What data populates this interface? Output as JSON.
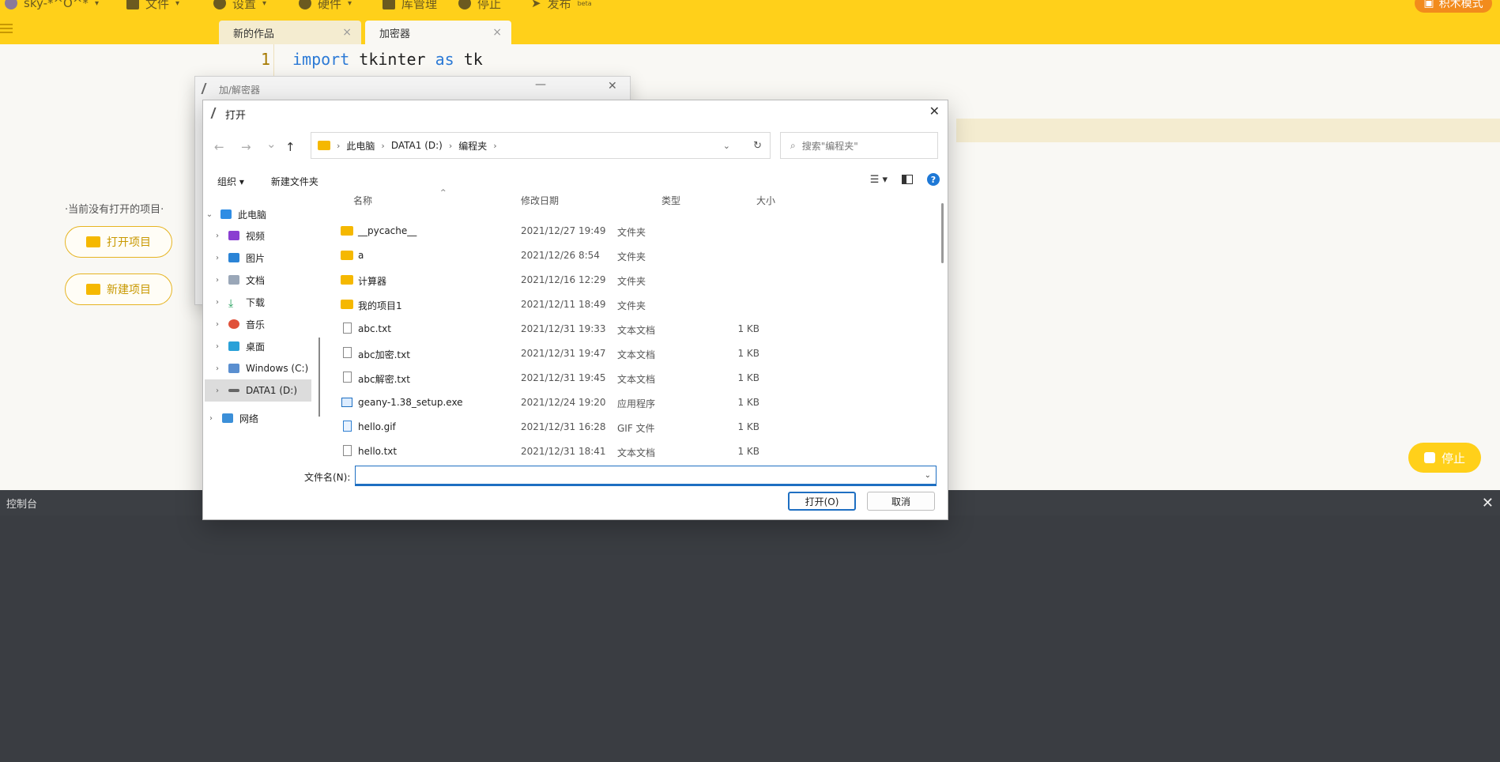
{
  "toolbar": {
    "user": "sky-*^O^*",
    "file": "文件",
    "settings": "设置",
    "hardware": "硬件",
    "library": "库管理",
    "stop": "停止",
    "publish": "发布",
    "publish_badge": "beta",
    "block_mode": "积木模式"
  },
  "tabs": [
    {
      "label": "新的作品",
      "close": "×"
    },
    {
      "label": "加密器",
      "close": "×"
    }
  ],
  "editor": {
    "line_number": "1",
    "code_kw1": "import",
    "code_mod": " tkinter ",
    "code_kw2": "as",
    "code_alias": " tk"
  },
  "project_pane": {
    "no_project": "·当前没有打开的项目·",
    "open_project": "打开项目",
    "new_project": "新建项目"
  },
  "stop_button": "停止",
  "console": {
    "title": "控制台",
    "close": "✕"
  },
  "bg_window": {
    "title": "加/解密器",
    "minimize": "—",
    "close": "✕"
  },
  "dialog": {
    "title": "打开",
    "close": "✕",
    "nav_back": "←",
    "nav_forward": "→",
    "nav_recent": "⌄",
    "nav_up": "↑",
    "breadcrumb": [
      "此电脑",
      "DATA1 (D:)",
      "编程夹"
    ],
    "search_placeholder": "搜索\"编程夹\"",
    "organize": "组织 ▾",
    "new_folder": "新建文件夹",
    "help": "?",
    "view_menu": "☰ ▾",
    "tree": [
      {
        "label": "此电脑",
        "expanded": true
      },
      {
        "label": "视频"
      },
      {
        "label": "图片"
      },
      {
        "label": "文档"
      },
      {
        "label": "下载"
      },
      {
        "label": "音乐"
      },
      {
        "label": "桌面"
      },
      {
        "label": "Windows (C:)"
      },
      {
        "label": "DATA1 (D:)",
        "selected": true
      },
      {
        "label": "网络"
      }
    ],
    "columns": {
      "name": "名称",
      "date": "修改日期",
      "type": "类型",
      "size": "大小"
    },
    "files": [
      {
        "name": "__pycache__",
        "date": "2021/12/27 19:49",
        "type": "文件夹",
        "size": "",
        "kind": "folder"
      },
      {
        "name": "a",
        "date": "2021/12/26 8:54",
        "type": "文件夹",
        "size": "",
        "kind": "folder"
      },
      {
        "name": "计算器",
        "date": "2021/12/16 12:29",
        "type": "文件夹",
        "size": "",
        "kind": "folder"
      },
      {
        "name": "我的项目1",
        "date": "2021/12/11 18:49",
        "type": "文件夹",
        "size": "",
        "kind": "folder"
      },
      {
        "name": "abc.txt",
        "date": "2021/12/31 19:33",
        "type": "文本文档",
        "size": "1 KB",
        "kind": "txt"
      },
      {
        "name": "abc加密.txt",
        "date": "2021/12/31 19:47",
        "type": "文本文档",
        "size": "1 KB",
        "kind": "txt"
      },
      {
        "name": "abc解密.txt",
        "date": "2021/12/31 19:45",
        "type": "文本文档",
        "size": "1 KB",
        "kind": "txt"
      },
      {
        "name": "geany-1.38_setup.exe",
        "date": "2021/12/24 19:20",
        "type": "应用程序",
        "size": "1 KB",
        "kind": "exe"
      },
      {
        "name": "hello.gif",
        "date": "2021/12/31 16:28",
        "type": "GIF 文件",
        "size": "1 KB",
        "kind": "gif"
      },
      {
        "name": "hello.txt",
        "date": "2021/12/31 18:41",
        "type": "文本文档",
        "size": "1 KB",
        "kind": "txt"
      }
    ],
    "filename_label": "文件名(N):",
    "filename_value": "",
    "open_button": "打开(O)",
    "cancel_button": "取消"
  },
  "colors": {
    "accent": "#ffd01a",
    "block_mode": "#f28b1c",
    "console": "#3a3d42",
    "selection": "#1e6fc2"
  }
}
